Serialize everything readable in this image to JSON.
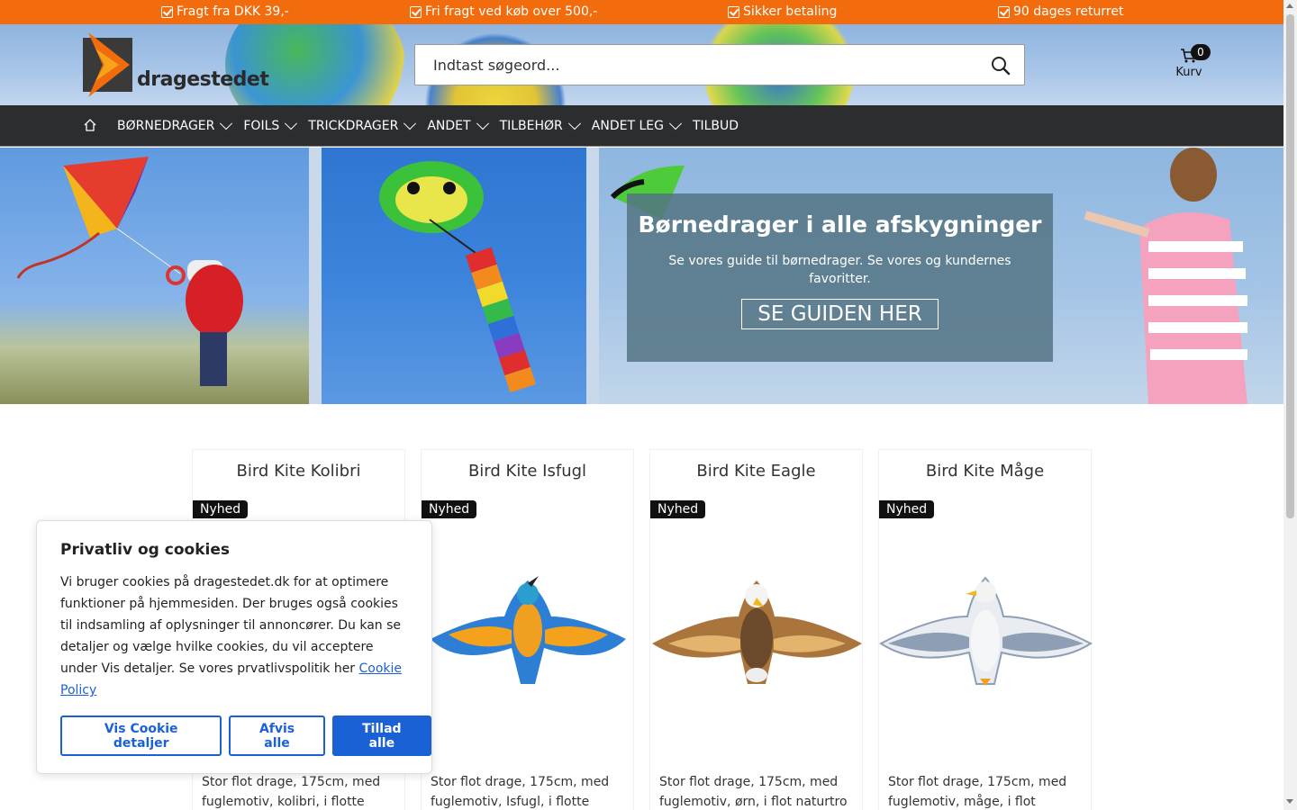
{
  "topbar": {
    "usps": [
      "Fragt fra DKK 39,-",
      "Fri fragt ved køb over 500,-",
      "Sikker betaling",
      "90 dages returret"
    ]
  },
  "header": {
    "logo_text": "dragestedet",
    "search_placeholder": "Indtast søgeord...",
    "cart_count": "0",
    "cart_label": "Kurv"
  },
  "nav": {
    "items": [
      {
        "label": "BØRNEDRAGER",
        "has_dropdown": true
      },
      {
        "label": "FOILS",
        "has_dropdown": true
      },
      {
        "label": "TRICKDRAGER",
        "has_dropdown": true
      },
      {
        "label": "ANDET",
        "has_dropdown": true
      },
      {
        "label": "TILBEHØR",
        "has_dropdown": true
      },
      {
        "label": "ANDET LEG",
        "has_dropdown": true
      },
      {
        "label": "TILBUD",
        "has_dropdown": false
      }
    ]
  },
  "hero": {
    "title": "Børnedrager i alle afskygninger",
    "subtitle": "Se vores guide til børnedrager. Se vores og kundernes favoritter.",
    "button_label": "SE GUIDEN HER"
  },
  "products": [
    {
      "title": "Bird Kite Kolibri",
      "badge": "Nyhed",
      "desc": "Stor flot drage, 175cm, med fuglemotiv, kolibri, i flotte",
      "colors": [
        "#2d7fd6",
        "#f4a21c"
      ]
    },
    {
      "title": "Bird Kite Isfugl",
      "badge": "Nyhed",
      "desc": "Stor flot drage, 175cm, med fuglemotiv, Isfugl, i flotte",
      "colors": [
        "#2f7fd8",
        "#f5a31b"
      ]
    },
    {
      "title": "Bird Kite Eagle",
      "badge": "Nyhed",
      "desc": "Stor flot drage, 175cm, med fuglemotiv, ørn, i flot naturtro",
      "colors": [
        "#a9753c",
        "#d9a35d"
      ]
    },
    {
      "title": "Bird Kite Måge",
      "badge": "Nyhed",
      "desc": "Stor flot drage, 175cm, med fuglemotiv, måge, i flot",
      "colors": [
        "#8e9fb5",
        "#e9edf2"
      ]
    }
  ],
  "cookie": {
    "title": "Privatliv og cookies",
    "text": "Vi bruger cookies på dragestedet.dk for at optimere funktioner på hjemmesiden. Der bruges også cookies til indsamling af oplysninger til annoncører. Du kan se detaljer og vælge hvilke cookies, du vil acceptere under Vis detaljer. Se vores prvatlivspolitik her",
    "link_label": "Cookie Policy",
    "buttons": {
      "details": "Vis Cookie detaljer",
      "reject": "Afvis alle",
      "accept": "Tillad alle"
    }
  },
  "colors": {
    "topbar": "#f26c0d",
    "nav": "#2b2d2f",
    "accent": "#1b61d6"
  }
}
